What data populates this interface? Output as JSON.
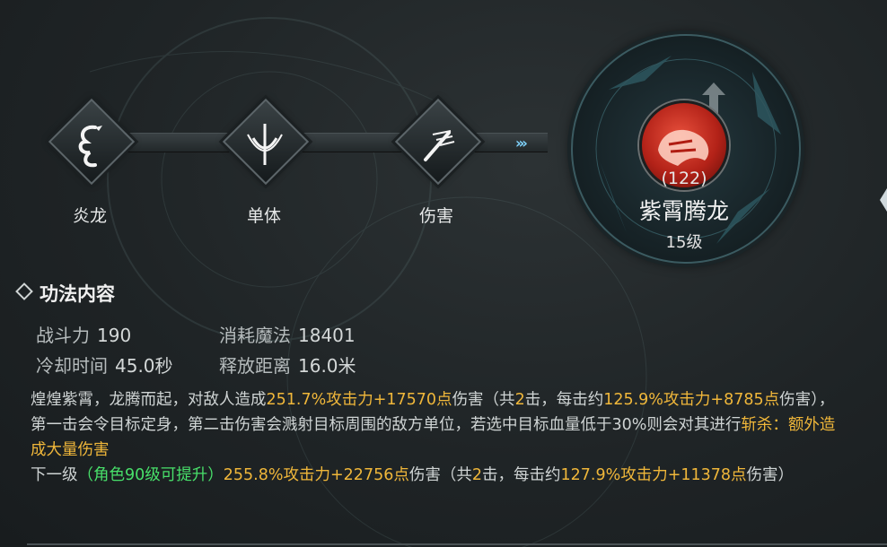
{
  "path_nodes": [
    {
      "label": "炎龙",
      "icon": "dragon-icon"
    },
    {
      "label": "单体",
      "icon": "single-target-icon"
    },
    {
      "label": "伤害",
      "icon": "damage-icon"
    }
  ],
  "path_arrows": "›››",
  "skill": {
    "count": "(122)",
    "name": "紫霄腾龙",
    "level": "15级",
    "icon": "red-dragon-head-icon",
    "upgrade_icon": "upgrade-arrow-icon"
  },
  "section_title": "功法内容",
  "stats": {
    "power_label": "战斗力",
    "power_value": "190",
    "mana_label": "消耗魔法",
    "mana_value": "18401",
    "cooldown_label": "冷却时间",
    "cooldown_value": "45.0秒",
    "range_label": "释放距离",
    "range_value": "16.0米"
  },
  "description": {
    "d1": "煌煌紫霄，龙腾而起，对敌人造成",
    "d2": "251.7%攻击力+17570点",
    "d3": "伤害（共",
    "d4": "2",
    "d5": "击，每击约",
    "d6": "125.9%攻击力+8785点",
    "d7": "伤害），第一击会令目标定身，第二击伤害会溅射目标周围的敌方单位，若选中目标血量低于30%则会对其进行",
    "d8": "斩杀：额外造成大量伤害",
    "n1": "下一级",
    "n2": "（角色90级可提升）",
    "n3": "255.8%攻击力+22756点",
    "n4": "伤害（共",
    "n5": "2",
    "n6": "击，每击约",
    "n7": "127.9%攻击力+11378点",
    "n8": "伤害）"
  },
  "colors": {
    "highlight_yellow": "#f0b73a",
    "highlight_green": "#48e06a",
    "arrow_blue": "#7fd4ff"
  }
}
